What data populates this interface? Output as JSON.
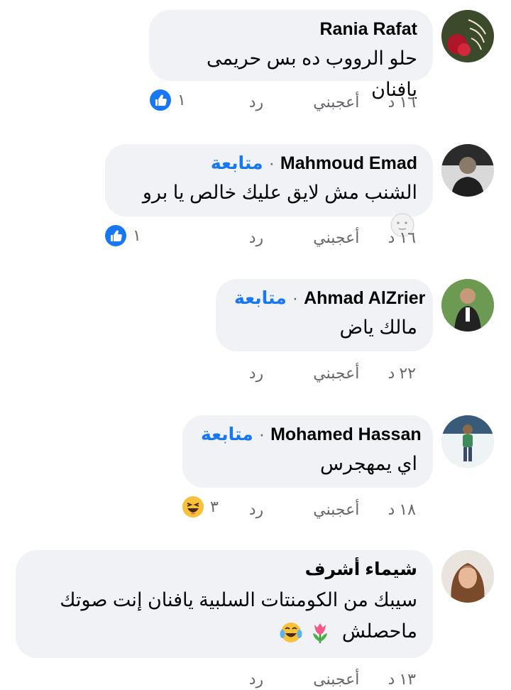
{
  "comments": [
    {
      "author": "Rania Rafat",
      "follow": "",
      "text": "حلو الرووب ده بس حريمى يافنان",
      "time": "١٦ د",
      "like_label": "أعجبني",
      "reply_label": "رد",
      "reaction_icon": "like-icon",
      "reaction_count": "١"
    },
    {
      "author": "Mahmoud Emad",
      "follow": "متابعة",
      "text": "الشنب مش لايق عليك خالص يا برو",
      "time": "١٦ د",
      "like_label": "أعجبني",
      "reply_label": "رد",
      "reaction_icon": "like-icon",
      "reaction_count": "١"
    },
    {
      "author": "Ahmad AlZrier",
      "follow": "متابعة",
      "text": "مالك ياض",
      "time": "٢٢ د",
      "like_label": "أعجبني",
      "reply_label": "رد"
    },
    {
      "author": "Mohamed Hassan",
      "follow": "متابعة",
      "text": "اي يمهجرس",
      "time": "١٨ د",
      "like_label": "أعجبني",
      "reply_label": "رد",
      "reaction_icon": "haha-icon",
      "reaction_count": "٣"
    },
    {
      "author": "شيماء أشرف",
      "follow": "",
      "text_line1": "سيبك من الكومنتات السلبية يافنان إنت صوتك",
      "text_line2": "ماحصلش",
      "time": "١٣ د",
      "like_label": "أعجبنى",
      "reply_label": "رد"
    }
  ],
  "colors": {
    "accent": "#1877f2",
    "bubble": "#f0f2f5",
    "meta": "#65676b"
  }
}
